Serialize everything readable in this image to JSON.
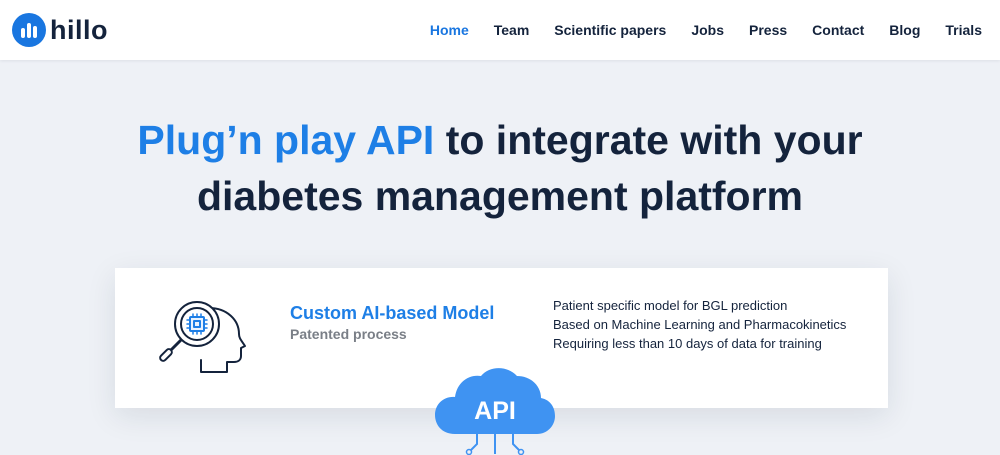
{
  "brand": {
    "name": "hillo",
    "color": "#1976e0"
  },
  "nav": {
    "items": [
      {
        "label": "Home",
        "active": true
      },
      {
        "label": "Team"
      },
      {
        "label": "Scientific papers"
      },
      {
        "label": "Jobs"
      },
      {
        "label": "Press"
      },
      {
        "label": "Contact"
      },
      {
        "label": "Blog"
      },
      {
        "label": "Trials"
      }
    ]
  },
  "hero": {
    "highlight": "Plug’n play API",
    "line1_rest": " to integrate with your",
    "line2": "diabetes management platform"
  },
  "card": {
    "icon": "head-magnifier-chip-icon",
    "title": "Custom AI-based Model",
    "subtitle": "Patented process",
    "features": [
      "Patient specific model for BGL prediction",
      "Based on Machine Learning and Pharmacokinetics",
      "Requiring less than 10 days of data for training"
    ]
  },
  "api_badge": {
    "icon": "cloud-icon",
    "label": "API"
  },
  "colors": {
    "accent": "#1e7fe6",
    "text_dark": "#14233c",
    "background": "#eef1f6",
    "subtitle_gray": "#7a7f87"
  }
}
